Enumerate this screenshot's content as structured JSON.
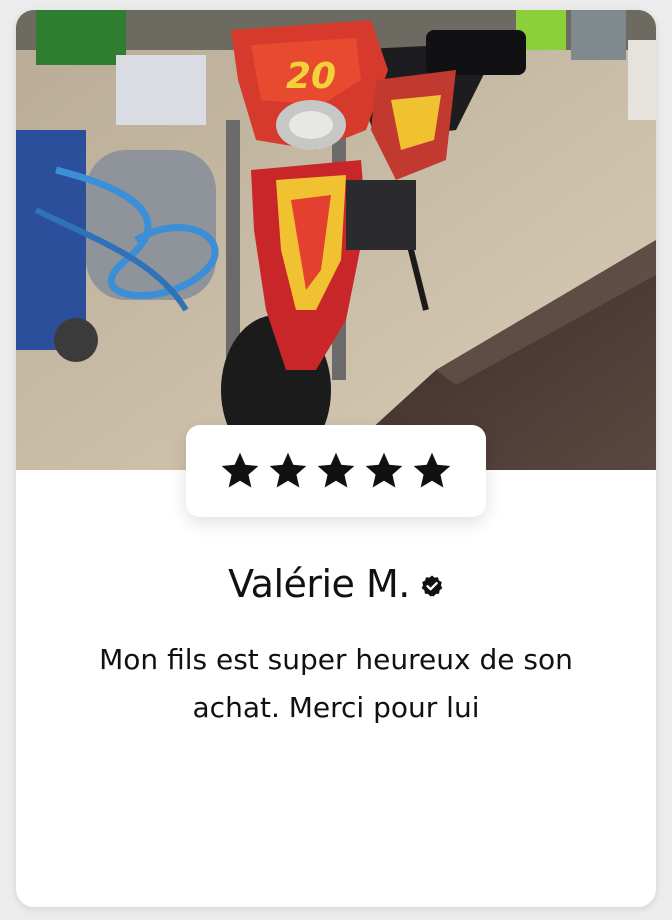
{
  "review_card": {
    "photo": {
      "subject": "motorbike photo",
      "bike_number": "20"
    },
    "rating": {
      "stars": 5,
      "max_stars": 5,
      "star_icon": "star-icon",
      "star_color": "#111111"
    },
    "reviewer": {
      "name": "Valérie M.",
      "verified": true,
      "verified_icon": "verified-badge-icon"
    },
    "review_text": "Mon fils est super heureux de son achat. Merci pour lui"
  }
}
